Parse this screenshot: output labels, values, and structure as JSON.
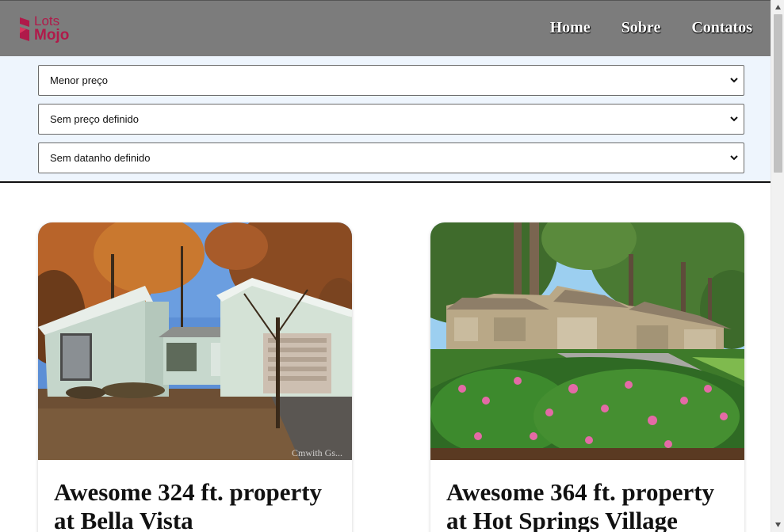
{
  "brand": {
    "logo_top": "Lots",
    "logo_bottom": "Mojo",
    "accent_color": "#b01a4a"
  },
  "nav": {
    "items": [
      {
        "label": "Home"
      },
      {
        "label": "Sobre"
      },
      {
        "label": "Contatos"
      }
    ]
  },
  "filters": {
    "sort": {
      "selected": "Menor preço"
    },
    "price": {
      "selected": "Sem preço definido"
    },
    "size": {
      "selected": "Sem datanho definido"
    }
  },
  "listings": [
    {
      "title": "Awesome 324 ft. property at Bella Vista",
      "image": "house-photo",
      "watermark": "Cmwith Gs..."
    },
    {
      "title": "Awesome 364 ft. property at Hot Springs Village",
      "image": "townhouse-photo"
    }
  ]
}
